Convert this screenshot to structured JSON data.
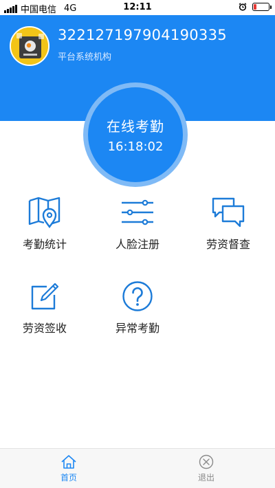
{
  "status_bar": {
    "carrier": "中国电信",
    "network": "4G",
    "time": "12:11",
    "battery_level": 0.2,
    "battery_color": "#e53935"
  },
  "header": {
    "id_number": "322127197904190335",
    "organization": "平台系统机构",
    "background": "#1c87f3"
  },
  "clock": {
    "label": "在线考勤",
    "time": "16:18:02"
  },
  "menu": [
    {
      "label": "考勤统计",
      "icon": "map-pin-icon"
    },
    {
      "label": "人脸注册",
      "icon": "sliders-icon"
    },
    {
      "label": "劳资督查",
      "icon": "chat-bubbles-icon"
    },
    {
      "label": "劳资签收",
      "icon": "edit-icon"
    },
    {
      "label": "异常考勤",
      "icon": "question-icon"
    }
  ],
  "tabbar": {
    "home_label": "首页",
    "logout_label": "退出",
    "active_color": "#1c87f3",
    "inactive_color": "#888888"
  }
}
